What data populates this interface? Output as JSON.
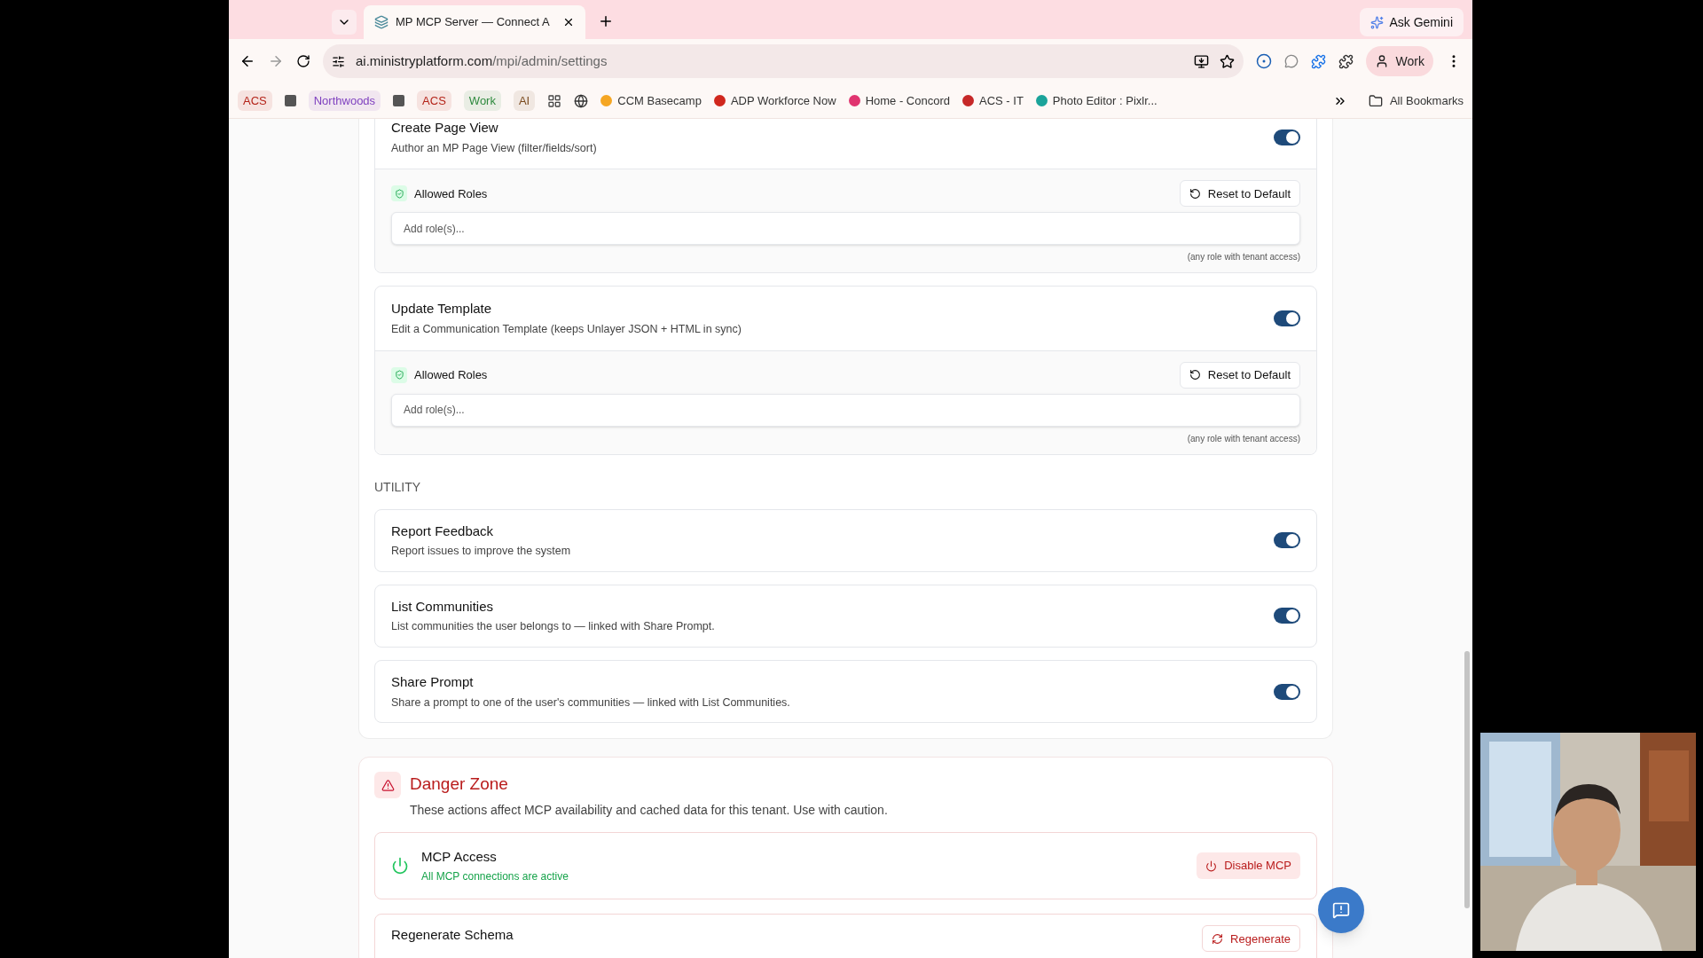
{
  "browser": {
    "tabs": [
      {
        "title": "MP MCP Server — Connect A",
        "selected": true
      }
    ],
    "ask_gemini": "Ask Gemini",
    "url_host": "ai.ministryplatform.com",
    "url_path": "/mpi/admin/settings",
    "profile": "Work",
    "bookmarks": [
      {
        "kind": "tag",
        "label": "ACS",
        "color": "#b42318"
      },
      {
        "kind": "square"
      },
      {
        "kind": "tag",
        "label": "Northwoods",
        "color": "#7e3fbf"
      },
      {
        "kind": "square"
      },
      {
        "kind": "tag",
        "label": "ACS",
        "color": "#b42318"
      },
      {
        "kind": "tag",
        "label": "Work",
        "color": "#2f8a3f"
      },
      {
        "kind": "tag",
        "label": "AI",
        "color": "#7a4a1e"
      },
      {
        "kind": "apps"
      },
      {
        "kind": "globe"
      },
      {
        "kind": "site",
        "label": "CCM Basecamp",
        "color": "#f5a623"
      },
      {
        "kind": "site",
        "label": "ADP Workforce Now",
        "color": "#d0271d"
      },
      {
        "kind": "site",
        "label": "Home - Concord",
        "color": "#e0346f"
      },
      {
        "kind": "site",
        "label": "ACS - IT",
        "color": "#c62828"
      },
      {
        "kind": "site",
        "label": "Photo Editor : Pixlr...",
        "color": "#1aa39a"
      }
    ],
    "all_bookmarks": "All Bookmarks"
  },
  "tool_groups": [
    {
      "tools": [
        {
          "name": "Create Page View",
          "description": "Author an MP Page View (filter/fields/sort)",
          "on": true,
          "roles": {
            "label": "Allowed Roles",
            "reset": "Reset to Default",
            "placeholder": "Add role(s)...",
            "note": "(any role with tenant access)"
          }
        },
        {
          "name": "Update Template",
          "description": "Edit a Communication Template (keeps Unlayer JSON + HTML in sync)",
          "on": true,
          "roles": {
            "label": "Allowed Roles",
            "reset": "Reset to Default",
            "placeholder": "Add role(s)...",
            "note": "(any role with tenant access)"
          }
        }
      ]
    },
    {
      "heading": "UTILITY",
      "tools": [
        {
          "name": "Report Feedback",
          "description": "Report issues to improve the system",
          "on": true
        },
        {
          "name": "List Communities",
          "description": "List communities the user belongs to — linked with Share Prompt.",
          "on": true
        },
        {
          "name": "Share Prompt",
          "description": "Share a prompt to one of the user's communities — linked with List Communities.",
          "on": true
        }
      ]
    }
  ],
  "danger_zone": {
    "title": "Danger Zone",
    "description": "These actions affect MCP availability and cached data for this tenant. Use with caution.",
    "actions": [
      {
        "name": "MCP Access",
        "status": "All MCP connections are active",
        "button": "Disable MCP",
        "kind": "power"
      },
      {
        "name": "Regenerate Schema",
        "button": "Regenerate",
        "kind": "refresh"
      }
    ]
  }
}
